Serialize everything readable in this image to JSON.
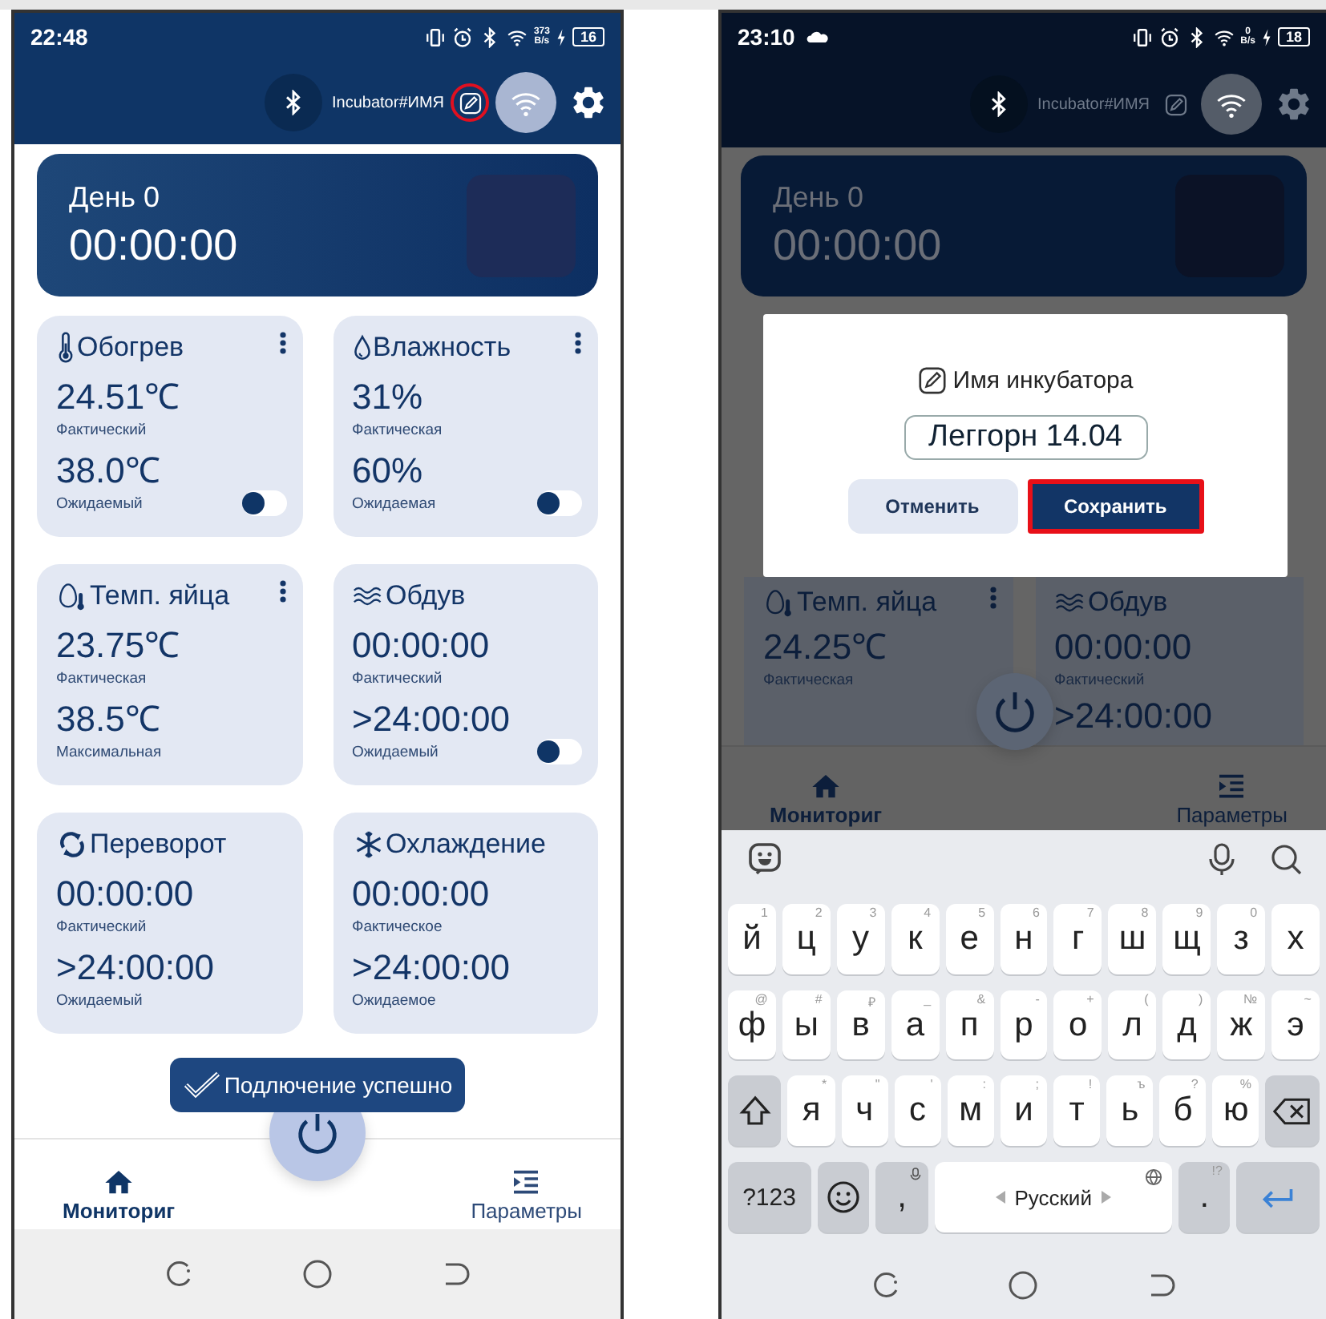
{
  "left_phone": {
    "status_bar": {
      "time": "22:48",
      "speed": "373",
      "speed_unit": "B/s",
      "battery": "16"
    },
    "app_bar": {
      "device_name": "Incubator#ИМЯ",
      "edit_highlighted": true
    },
    "day_card": {
      "day": "День 0",
      "timer": "00:00:00"
    },
    "cards": [
      {
        "kind": "heating",
        "title": "Обогрев",
        "menu": true,
        "readings": [
          {
            "value": "24.51℃",
            "label": "Фактический"
          },
          {
            "value": "38.0℃",
            "label": "Ожидаемый"
          }
        ],
        "toggle": {
          "on": false
        }
      },
      {
        "kind": "humidity",
        "title": "Влажность",
        "menu": true,
        "readings": [
          {
            "value": "31%",
            "label": "Фактическая"
          },
          {
            "value": "60%",
            "label": "Ожидаемая"
          }
        ],
        "toggle": {
          "on": false
        }
      },
      {
        "kind": "egg",
        "title": "Темп. яйца",
        "menu": true,
        "readings": [
          {
            "value": "23.75℃",
            "label": "Фактическая"
          },
          {
            "value": "38.5℃",
            "label": "Максимальная"
          }
        ]
      },
      {
        "kind": "airflow",
        "title": "Обдув",
        "menu": false,
        "readings": [
          {
            "value": "00:00:00",
            "label": "Фактический"
          },
          {
            "value": ">24:00:00",
            "label": "Ожидаемый"
          }
        ],
        "toggle": {
          "on": false
        }
      },
      {
        "kind": "turning",
        "title": "Переворот",
        "menu": false,
        "readings": [
          {
            "value": "00:00:00",
            "label": "Фактический"
          },
          {
            "value": ">24:00:00",
            "label": "Ожидаемый"
          }
        ]
      },
      {
        "kind": "cooling",
        "title": "Охлаждение",
        "menu": false,
        "readings": [
          {
            "value": "00:00:00",
            "label": "Фактическое"
          },
          {
            "value": ">24:00:00",
            "label": "Ожидаемое"
          }
        ]
      }
    ],
    "toast": {
      "text": "Подлючение успешно"
    },
    "bottom_nav": [
      {
        "kind": "home",
        "label": "Мониториг",
        "selected": true
      },
      {
        "kind": "params",
        "label": "Параметры",
        "selected": false
      }
    ]
  },
  "right_phone": {
    "status_bar": {
      "time": "23:10",
      "speed": "0",
      "speed_unit": "B/s",
      "battery": "18"
    },
    "app_bar": {
      "device_name": "Incubator#ИМЯ",
      "edit_highlighted": false
    },
    "day_card": {
      "day": "День 0",
      "timer": "00:00:00"
    },
    "dialog": {
      "title": "Имя инкубатора",
      "value": "Леггорн 14.04",
      "buttons": [
        {
          "kind": "secondary",
          "label": "Отменить",
          "highlighted": false
        },
        {
          "kind": "primary",
          "label": "Сохранить",
          "highlighted": true
        }
      ]
    },
    "cards": [
      {
        "kind": "egg",
        "title": "Темп. яйца",
        "menu": true,
        "readings": [
          {
            "value": "24.25℃",
            "label": "Фактическая"
          }
        ]
      },
      {
        "kind": "airflow",
        "title": "Обдув",
        "menu": false,
        "readings": [
          {
            "value": "00:00:00",
            "label": "Фактический"
          },
          {
            "value": ">24:00:00"
          }
        ]
      }
    ],
    "bottom_nav": [
      {
        "kind": "home",
        "label": "Мониториг",
        "selected": true
      },
      {
        "kind": "params",
        "label": "Параметры",
        "selected": false
      }
    ],
    "keyboard": {
      "rows": [
        {
          "keys": [
            {
              "kind": "letter",
              "label": "й",
              "hint": "1"
            },
            {
              "kind": "letter",
              "label": "ц",
              "hint": "2"
            },
            {
              "kind": "letter",
              "label": "у",
              "hint": "3"
            },
            {
              "kind": "letter",
              "label": "к",
              "hint": "4"
            },
            {
              "kind": "letter",
              "label": "е",
              "hint": "5"
            },
            {
              "kind": "letter",
              "label": "н",
              "hint": "6"
            },
            {
              "kind": "letter",
              "label": "г",
              "hint": "7"
            },
            {
              "kind": "letter",
              "label": "ш",
              "hint": "8"
            },
            {
              "kind": "letter",
              "label": "щ",
              "hint": "9"
            },
            {
              "kind": "letter",
              "label": "з",
              "hint": "0"
            },
            {
              "kind": "letter",
              "label": "х"
            }
          ]
        },
        {
          "keys": [
            {
              "kind": "letter",
              "label": "ф",
              "hint": "@"
            },
            {
              "kind": "letter",
              "label": "ы",
              "hint": "#"
            },
            {
              "kind": "letter",
              "label": "в",
              "hint": "₽"
            },
            {
              "kind": "letter",
              "label": "а",
              "hint": "_"
            },
            {
              "kind": "letter",
              "label": "п",
              "hint": "&"
            },
            {
              "kind": "letter",
              "label": "р",
              "hint": "-"
            },
            {
              "kind": "letter",
              "label": "о",
              "hint": "+"
            },
            {
              "kind": "letter",
              "label": "л",
              "hint": "("
            },
            {
              "kind": "letter",
              "label": "д",
              "hint": ")"
            },
            {
              "kind": "letter",
              "label": "ж",
              "hint": "№"
            },
            {
              "kind": "letter",
              "label": "э",
              "hint": "~"
            }
          ]
        },
        {
          "keys": [
            {
              "kind": "shift"
            },
            {
              "kind": "letter",
              "label": "я",
              "hint": "*"
            },
            {
              "kind": "letter",
              "label": "ч",
              "hint": "\""
            },
            {
              "kind": "letter",
              "label": "с",
              "hint": "'"
            },
            {
              "kind": "letter",
              "label": "м",
              "hint": ":"
            },
            {
              "kind": "letter",
              "label": "и",
              "hint": ";"
            },
            {
              "kind": "letter",
              "label": "т",
              "hint": "!"
            },
            {
              "kind": "letter",
              "label": "ь",
              "hint": "ъ"
            },
            {
              "kind": "letter",
              "label": "б",
              "hint": "?"
            },
            {
              "kind": "letter",
              "label": "ю",
              "hint": "%"
            },
            {
              "kind": "backspace"
            }
          ]
        },
        {
          "keys": [
            {
              "kind": "symbols",
              "label": "?123"
            },
            {
              "kind": "emoji"
            },
            {
              "kind": "comma",
              "label": ","
            },
            {
              "kind": "space",
              "label": "Русский"
            },
            {
              "kind": "period",
              "label": ".",
              "hint": "!?"
            },
            {
              "kind": "enter"
            }
          ]
        }
      ]
    }
  }
}
